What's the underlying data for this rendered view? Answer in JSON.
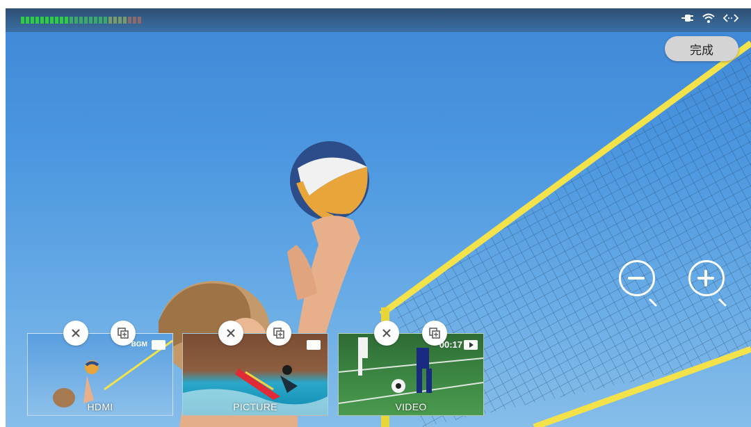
{
  "topbar": {
    "meter_colors": [
      "#2ecc40",
      "#2ecc40",
      "#2ecc40",
      "#2ecc40",
      "#2ecc40",
      "#2ecc40",
      "#2ecc40",
      "#2ecc40",
      "#2ecc40",
      "#2ecc40",
      "#3aa96a",
      "#3aa96a",
      "#3aa96a",
      "#3aa96a",
      "#3aa96a",
      "#3aa96a",
      "#3aa96a",
      "#3aa96a",
      "#7a9a6a",
      "#7a9a6a",
      "#7a9a6a",
      "#7a9a6a",
      "#8a6a6a",
      "#8a6a6a",
      "#8a6a6a"
    ],
    "status_icons": [
      "power-plug-icon",
      "wifi-icon",
      "network-arrows-icon"
    ]
  },
  "done_button": {
    "label": "完成"
  },
  "zoom": {
    "zoom_out": "zoom-out-icon",
    "zoom_in": "zoom-in-icon"
  },
  "sources": [
    {
      "label": "HDMI",
      "badge": "BGM",
      "type_icon": "image-icon"
    },
    {
      "label": "PICTURE",
      "badge": "",
      "type_icon": "image-icon"
    },
    {
      "label": "VIDEO",
      "badge": "00:17",
      "type_icon": "play-icon"
    }
  ],
  "colors": {
    "sky": "#4c97e0",
    "net_pole": "#f3e24a",
    "done_bg": "#d4d4d4"
  }
}
